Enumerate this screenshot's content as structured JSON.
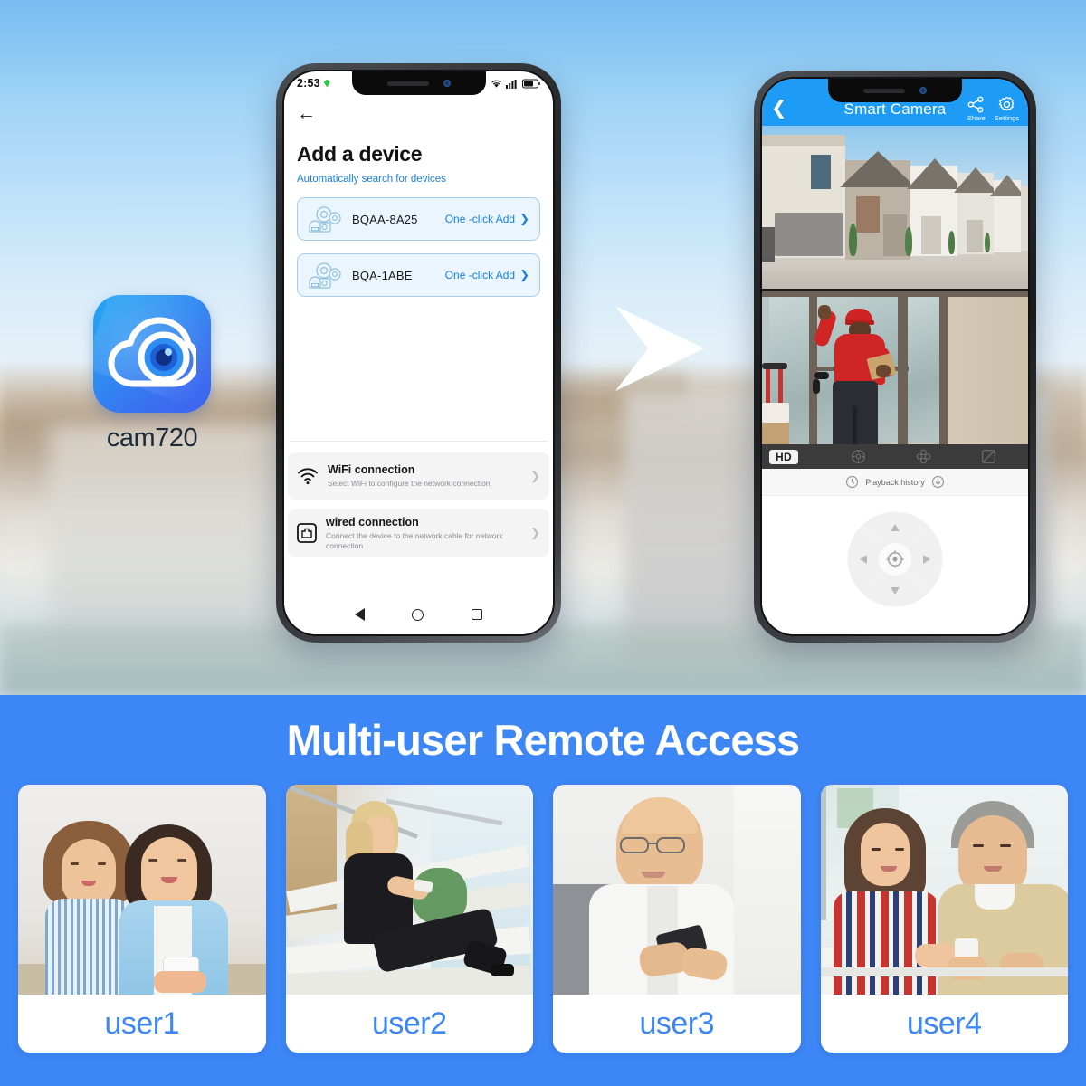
{
  "app": {
    "icon_name": "cloud-camera-icon",
    "label": "cam720",
    "brand_blue": "#2f8ef2"
  },
  "phone1": {
    "status_bar": {
      "time": "2:53",
      "location_icon": "location-arrow-icon",
      "wifi_icon": "wifi-icon",
      "signal_icon": "cellular-signal-icon",
      "battery_icon": "battery-icon"
    },
    "back_icon": "back-arrow-icon",
    "title": "Add a device",
    "subtitle": "Automatically search for devices",
    "devices": [
      {
        "name": "BQAA-8A25",
        "action": "One -click Add",
        "icon": "camera-group-icon"
      },
      {
        "name": "BQA-1ABE",
        "action": "One -click Add",
        "icon": "camera-group-icon"
      }
    ],
    "connections": [
      {
        "title": "WiFi connection",
        "desc": "Select WiFi to configure the network connection",
        "icon": "wifi-icon"
      },
      {
        "title": "wired connection",
        "desc": "Connect the device to the network cable for network connection",
        "icon": "ethernet-port-icon"
      }
    ],
    "nav": {
      "back": "nav-back-triangle-icon",
      "home": "nav-home-circle-icon",
      "recents": "nav-recents-square-icon"
    }
  },
  "phone2": {
    "header": {
      "back_icon": "back-chevron-icon",
      "title": "Smart Camera",
      "actions": [
        {
          "label": "Share",
          "icon": "share-nodes-icon"
        },
        {
          "label": "Settings",
          "icon": "gear-icon"
        }
      ],
      "bar_color": "#1e9bf5"
    },
    "feeds": [
      {
        "name": "townhouse-street-camera-feed"
      },
      {
        "name": "delivery-person-door-camera-feed"
      }
    ],
    "control_bar": {
      "quality_badge": "HD",
      "icons": [
        "crosshair-target-icon",
        "four-screen-split-icon",
        "fullscreen-expand-icon"
      ]
    },
    "playback": {
      "left_icon": "history-clock-icon",
      "label": "Playback history",
      "right_icon": "download-arrow-icon"
    },
    "dpad": {
      "up": "dpad-up-icon",
      "down": "dpad-down-icon",
      "left": "dpad-left-icon",
      "right": "dpad-right-icon",
      "center": "dpad-center-icon"
    }
  },
  "flow_arrow": {
    "name": "flow-arrow-icon"
  },
  "bottom": {
    "banner_title": "Multi-user Remote Access",
    "bg_color": "#3d86f5",
    "label_color": "#3d86f5",
    "users": [
      {
        "label": "user1",
        "photo": "two-women-with-phone-photo"
      },
      {
        "label": "user2",
        "photo": "woman-on-stairs-with-phone-photo"
      },
      {
        "label": "user3",
        "photo": "man-with-glasses-phone-photo"
      },
      {
        "label": "user4",
        "photo": "young-woman-and-senior-man-phone-photo"
      }
    ]
  }
}
